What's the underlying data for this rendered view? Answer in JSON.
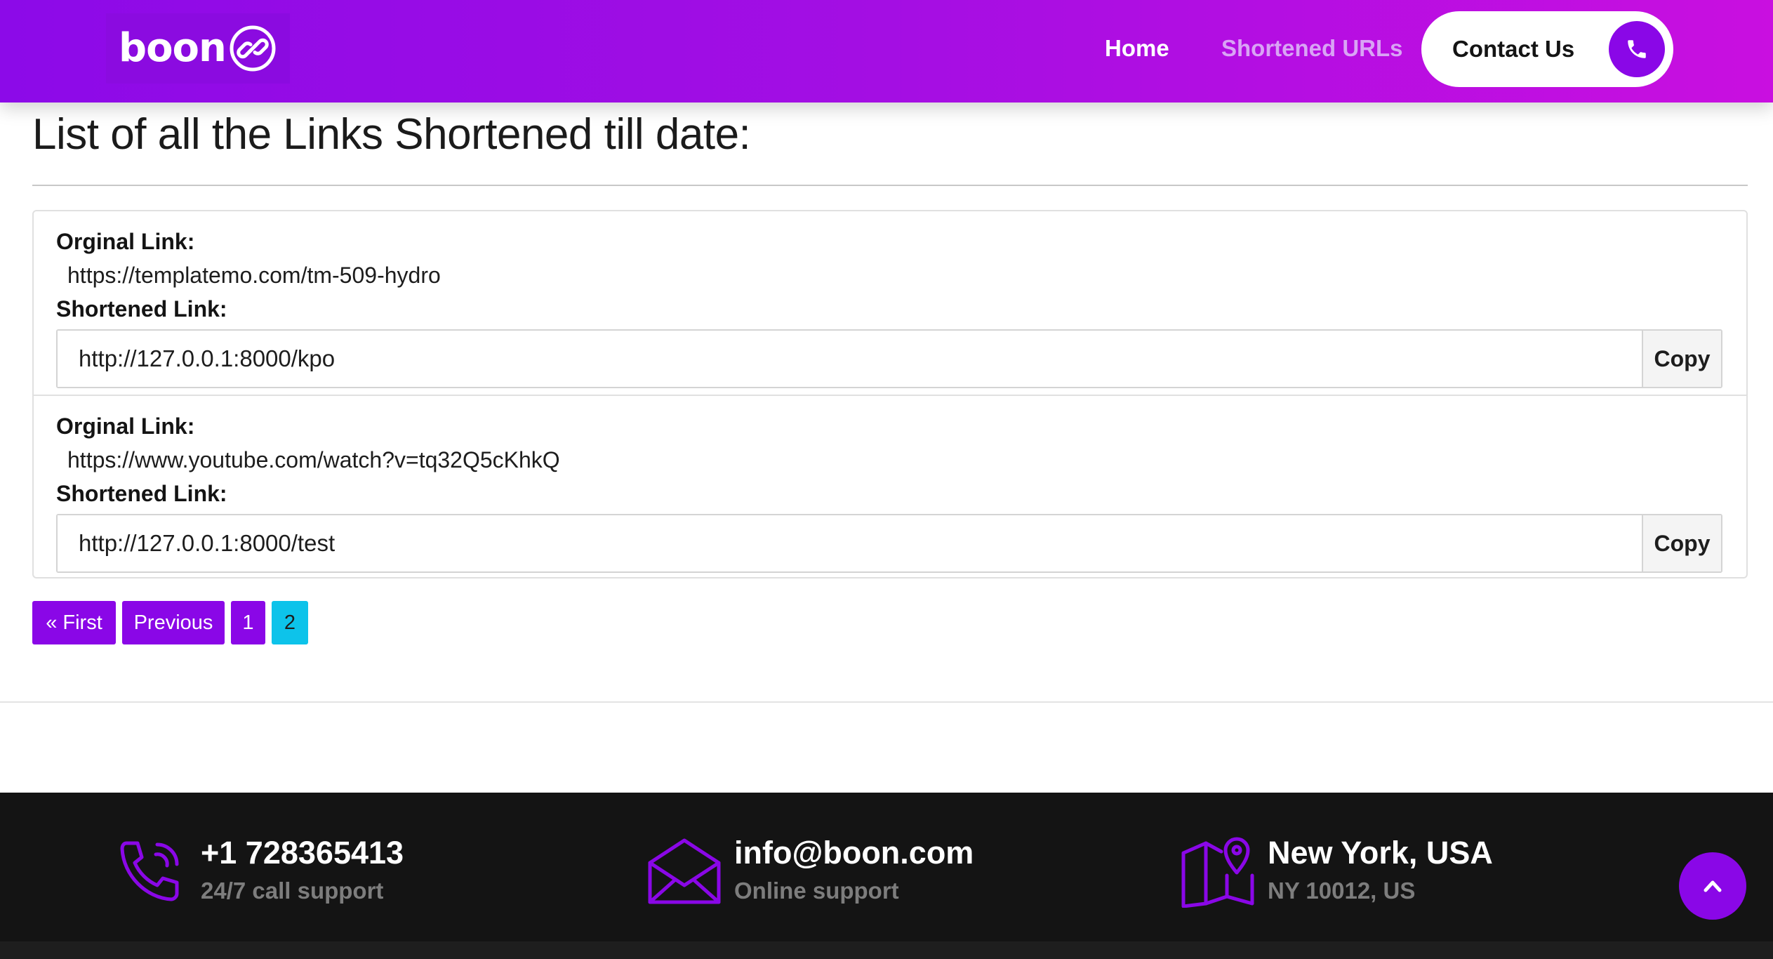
{
  "header": {
    "logo_text": "boon",
    "nav": {
      "home": "Home",
      "shortened_urls": "Shortened URLs"
    },
    "contact_label": "Contact Us"
  },
  "main": {
    "title": "List of all the Links Shortened till date:",
    "links": [
      {
        "original_label": "Orginal Link:",
        "original_url": "https://templatemo.com/tm-509-hydro",
        "short_label": "Shortened Link:",
        "short_url": "http://127.0.0.1:8000/kpo",
        "copy_label": "Copy"
      },
      {
        "original_label": "Orginal Link:",
        "original_url": "https://www.youtube.com/watch?v=tq32Q5cKhkQ",
        "short_label": "Shortened Link:",
        "short_url": "http://127.0.0.1:8000/test",
        "copy_label": "Copy"
      }
    ],
    "pagination": {
      "first": "« First",
      "previous": "Previous",
      "pages": [
        "1",
        "2"
      ],
      "current_page": "2"
    }
  },
  "footer": {
    "phone": {
      "main": "+1 728365413",
      "sub": "24/7 call support"
    },
    "email": {
      "main": "info@boon.com",
      "sub": "Online support"
    },
    "location": {
      "main": "New York, USA",
      "sub": "NY 10012, US"
    }
  },
  "colors": {
    "brand_purple": "#8a07e7",
    "header_gradient_end": "#c90fe0",
    "active_page": "#0dc3ea",
    "footer_bg": "#141414"
  },
  "icons": {
    "logo": "link-chain-icon",
    "contact": "phone-icon",
    "footer_phone": "phone-ringing-icon",
    "footer_email": "envelope-open-icon",
    "footer_location": "map-pin-icon",
    "scroll_top": "chevron-up-icon"
  }
}
